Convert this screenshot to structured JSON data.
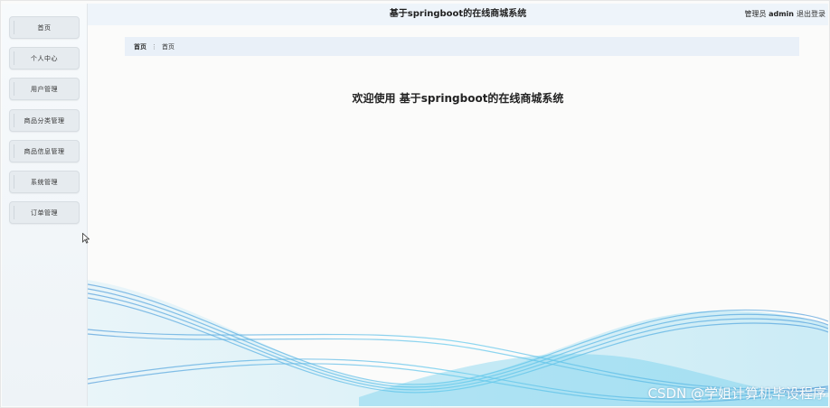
{
  "app": {
    "title": "基于springboot的在线商城系统",
    "user_role": "管理员",
    "user_name": "admin",
    "logout": "退出登录"
  },
  "sidebar": {
    "items": [
      {
        "label": "首页"
      },
      {
        "label": "个人中心"
      },
      {
        "label": "用户管理"
      },
      {
        "label": "商品分类管理"
      },
      {
        "label": "商品信息管理"
      },
      {
        "label": "系统管理"
      },
      {
        "label": "订单管理"
      }
    ]
  },
  "breadcrumb": {
    "home": "首页",
    "current": "首页"
  },
  "main": {
    "welcome": "欢迎使用 基于springboot的在线商城系统"
  },
  "watermark": "CSDN @学姐计算机毕设程序",
  "colors": {
    "wave_light": "#bfe7f7",
    "wave_mid": "#5cc8ec",
    "wave_dark": "#3a8fd6"
  }
}
